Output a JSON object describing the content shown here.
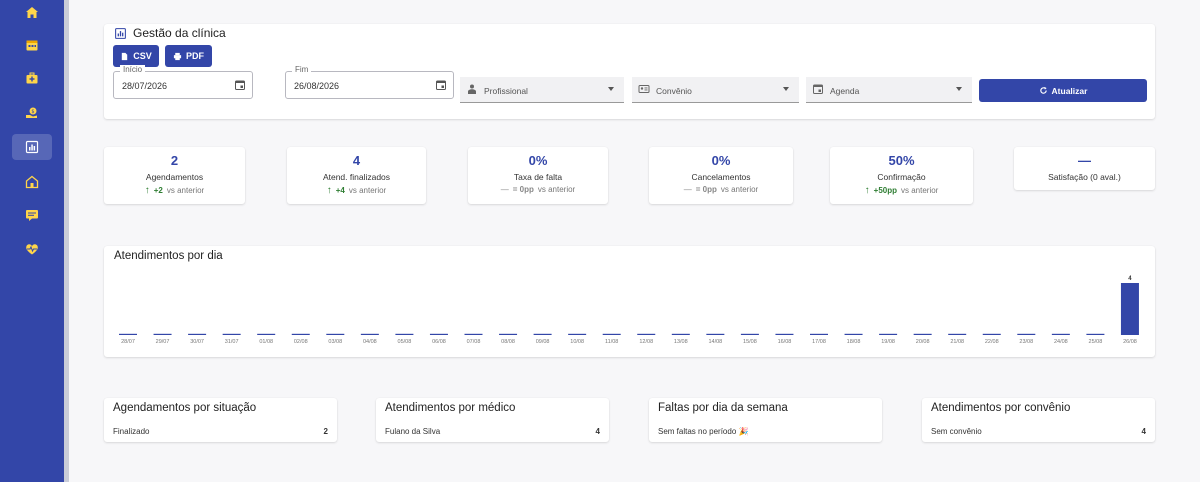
{
  "header": {
    "title": "Gestão da clínica",
    "csv_label": "CSV",
    "pdf_label": "PDF"
  },
  "filters": {
    "start": {
      "label": "Início",
      "value": "28/07/2026"
    },
    "end": {
      "label": "Fim",
      "value": "26/08/2026"
    },
    "professional": "Profissional",
    "insurance": "Convênio",
    "schedule": "Agenda",
    "refresh_label": "Atualizar"
  },
  "kpis": [
    {
      "value": "2",
      "label": "Agendamentos",
      "arrow": "↑",
      "delta": "+2",
      "suffix": "vs anterior",
      "trend": "up"
    },
    {
      "value": "4",
      "label": "Atend. finalizados",
      "arrow": "↑",
      "delta": "+4",
      "suffix": "vs anterior",
      "trend": "up"
    },
    {
      "value": "0%",
      "label": "Taxa de falta",
      "arrow": "—",
      "delta": "= 0pp",
      "suffix": "vs anterior",
      "trend": "flat"
    },
    {
      "value": "0%",
      "label": "Cancelamentos",
      "arrow": "—",
      "delta": "= 0pp",
      "suffix": "vs anterior",
      "trend": "flat"
    },
    {
      "value": "50%",
      "label": "Confirmação",
      "arrow": "↑",
      "delta": "+50pp",
      "suffix": "vs anterior",
      "trend": "up"
    },
    {
      "value": "—",
      "label": "Satisfação (0 aval.)",
      "arrow": "",
      "delta": "",
      "suffix": "",
      "trend": "none"
    }
  ],
  "chart_title": "Atendimentos por dia",
  "chart_data": {
    "type": "bar",
    "title": "Atendimentos por dia",
    "categories": [
      "28/07",
      "29/07",
      "30/07",
      "31/07",
      "01/08",
      "02/08",
      "03/08",
      "04/08",
      "05/08",
      "06/08",
      "07/08",
      "08/08",
      "09/08",
      "10/08",
      "11/08",
      "12/08",
      "13/08",
      "14/08",
      "15/08",
      "16/08",
      "17/08",
      "18/08",
      "19/08",
      "20/08",
      "21/08",
      "22/08",
      "23/08",
      "24/08",
      "25/08",
      "26/08"
    ],
    "values": [
      0,
      0,
      0,
      0,
      0,
      0,
      0,
      0,
      0,
      0,
      0,
      0,
      0,
      0,
      0,
      0,
      0,
      0,
      0,
      0,
      0,
      0,
      0,
      0,
      0,
      0,
      0,
      0,
      0,
      4
    ],
    "data_labels": [
      "",
      "",
      "",
      "",
      "",
      "",
      "",
      "",
      "",
      "",
      "",
      "",
      "",
      "",
      "",
      "",
      "",
      "",
      "",
      "",
      "",
      "",
      "",
      "",
      "",
      "",
      "",
      "",
      "",
      "4"
    ],
    "ylim": [
      0,
      4
    ],
    "color": "#3346a8"
  },
  "cards": [
    {
      "title": "Agendamentos por situação",
      "row_label": "Finalizado",
      "row_value": "2"
    },
    {
      "title": "Atendimentos por médico",
      "row_label": "Fulano da Silva",
      "row_value": "4"
    },
    {
      "title": "Faltas por dia da semana",
      "row_label": "Sem faltas no período 🎉",
      "row_value": ""
    },
    {
      "title": "Atendimentos por convênio",
      "row_label": "Sem convênio",
      "row_value": "4"
    }
  ],
  "colors": {
    "primary": "#3346a8",
    "positive": "#2e7d32"
  }
}
